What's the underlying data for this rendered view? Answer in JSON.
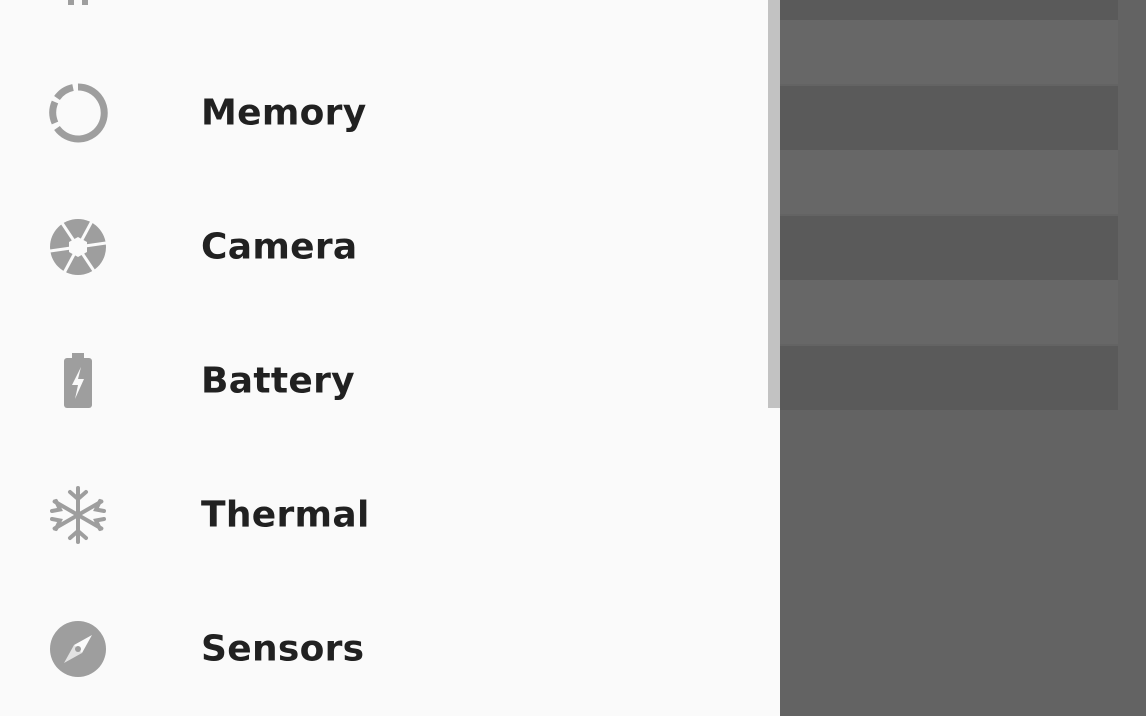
{
  "drawer": {
    "items": [
      {
        "label": "",
        "icon": "storage-icon"
      },
      {
        "label": "Memory",
        "icon": "memory-ring-icon"
      },
      {
        "label": "Camera",
        "icon": "camera-aperture-icon"
      },
      {
        "label": "Battery",
        "icon": "battery-charging-icon"
      },
      {
        "label": "Thermal",
        "icon": "snowflake-icon"
      },
      {
        "label": "Sensors",
        "icon": "compass-icon"
      }
    ],
    "icon_color": "#9e9e9e",
    "label_color": "#212121"
  },
  "scrim": {
    "color": "#636363"
  }
}
